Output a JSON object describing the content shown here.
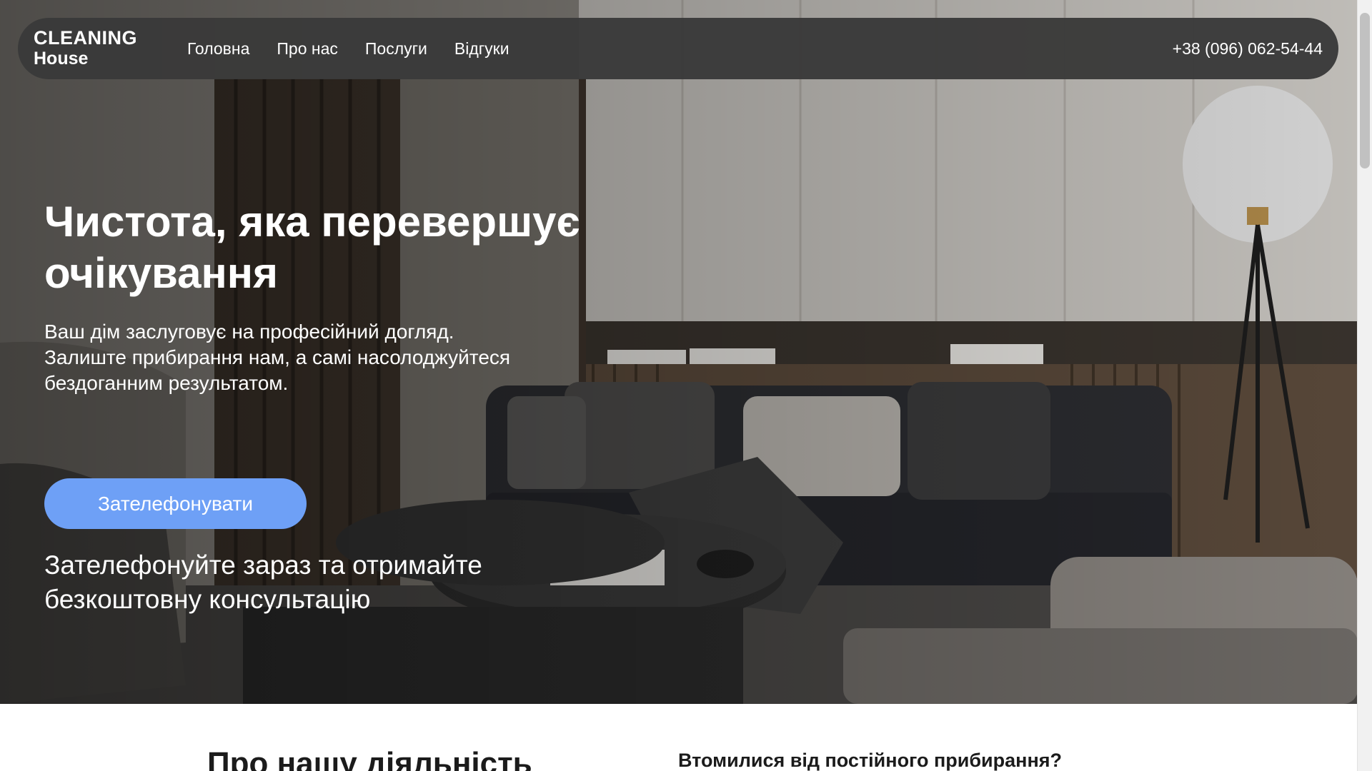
{
  "brand": {
    "line1": "CLEANING",
    "line2": "House"
  },
  "nav": {
    "items": [
      {
        "label": "Головна"
      },
      {
        "label": "Про нас"
      },
      {
        "label": "Послуги"
      },
      {
        "label": "Відгуки"
      }
    ],
    "phone": "+38 (096) 062-54-44"
  },
  "hero": {
    "title": "Чистота, яка перевершує очікування",
    "subtitle": "Ваш дім заслуговує на професійний догляд. Залиште прибирання нам, а самі насолоджуйтеся бездоганним результатом.",
    "cta_label": "Зателефонувати",
    "cta_note": "Зателефонуйте зараз та отримайте безкоштовну консультацію"
  },
  "about": {
    "title": "Про нашу діяльність",
    "question": "Втомилися від постійного прибирання?"
  },
  "colors": {
    "accent": "#6ea0f6",
    "navbar": "#3a3a3a"
  }
}
